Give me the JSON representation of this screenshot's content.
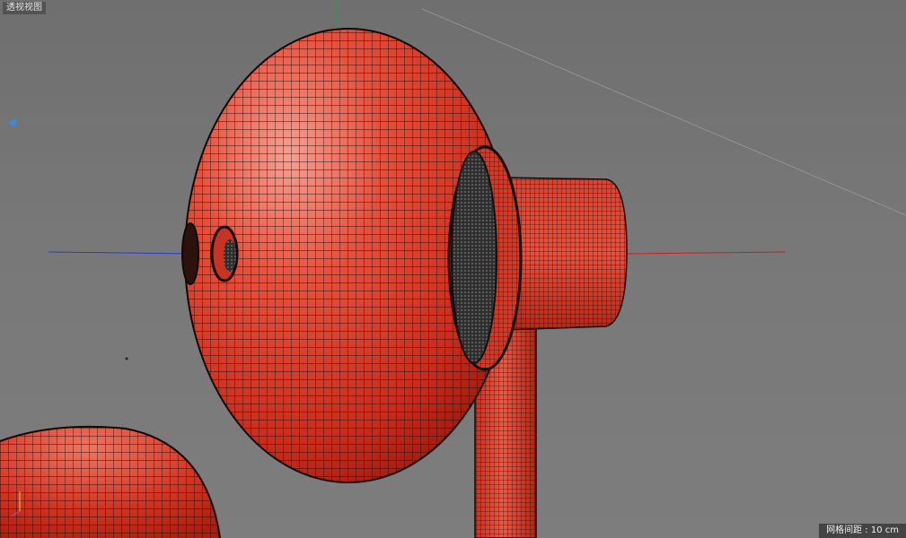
{
  "viewport": {
    "label": "透视视图",
    "grid_spacing": "网格间距 : 10 cm"
  },
  "colors": {
    "background": "#777777",
    "mesh_red": "#d83a28",
    "mesh_highlight": "#f08a7c",
    "wire": "#1a0a08",
    "axis_x": "#c82020",
    "axis_z": "#2a3ac8",
    "axis_y": "#1fa14a",
    "speaker_mesh": "#3a3a3a"
  },
  "scene": {
    "objects": [
      "earbud-head",
      "earbud-stem",
      "earbud-neck",
      "second-earbud"
    ],
    "axes": [
      "x-axis",
      "z-axis",
      "y-axis"
    ]
  }
}
